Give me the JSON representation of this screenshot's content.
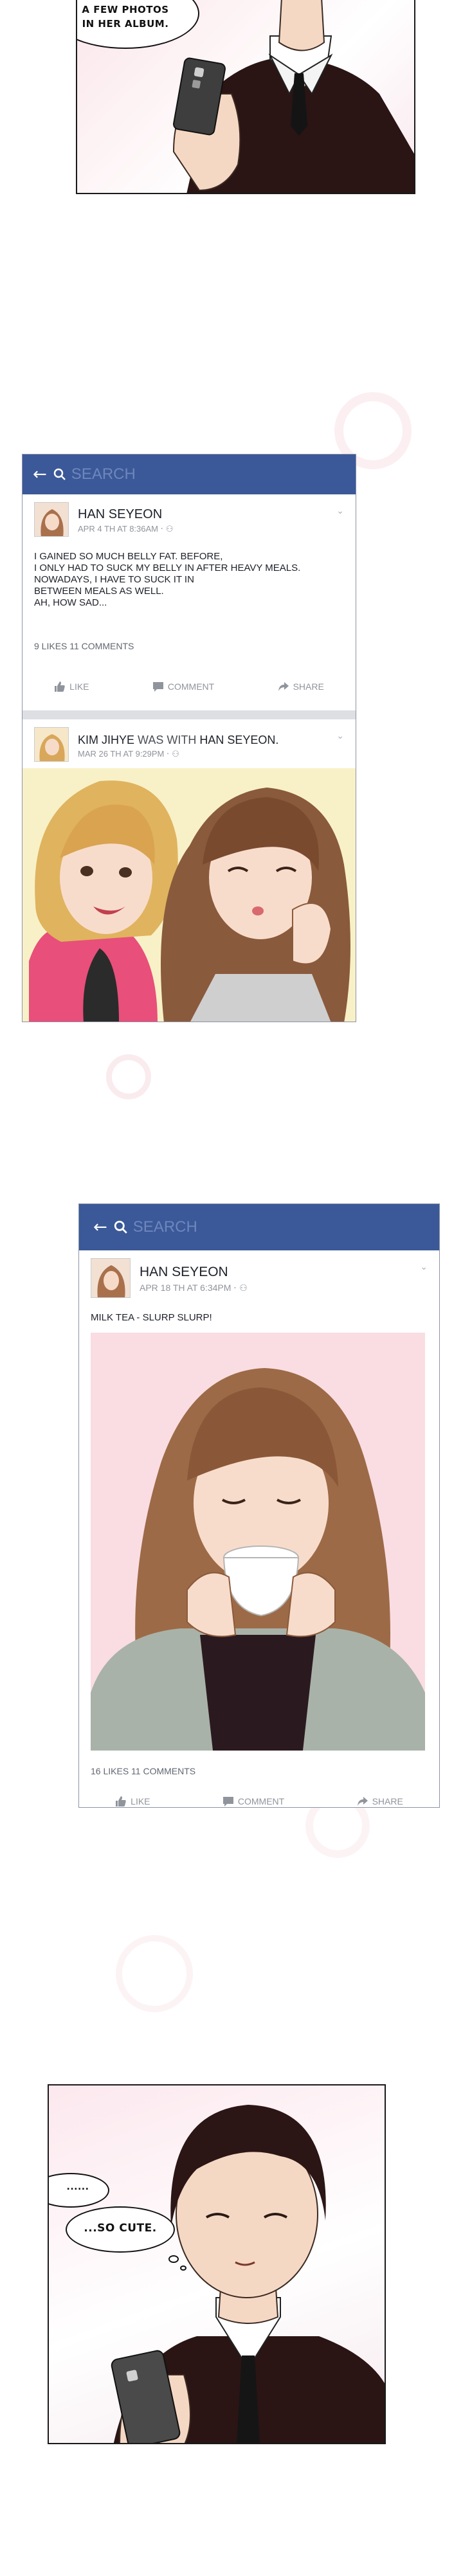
{
  "panel1": {
    "bubble": "A FEW PHOTOS IN HER ALBUM."
  },
  "feed1": {
    "back_icon": "arrow-left-icon",
    "search_placeholder": "SEARCH",
    "post1": {
      "name": "HAN SEYEON",
      "meta": "APR 4 TH AT 8:36AM",
      "text_lines": [
        "I GAINED SO MUCH BELLY FAT. BEFORE,",
        "I ONLY HAD TO SUCK MY BELLY IN AFTER HEAVY MEALS.",
        "NOWADAYS, I HAVE TO SUCK IT IN",
        "BETWEEN MEALS AS WELL.",
        "AH, HOW SAD..."
      ],
      "counts": "9 LIKES 11 COMMENTS",
      "like": "LIKE",
      "comment": "COMMENT",
      "share": "SHARE"
    },
    "post2": {
      "name_first": "KIM JIHYE",
      "name_mid": "WAS WITH",
      "name_second": "HAN SEYEON.",
      "meta": "MAR 26 TH AT 9:29PM"
    }
  },
  "feed2": {
    "back_icon": "arrow-left-icon",
    "search_placeholder": "SEARCH",
    "post": {
      "name": "HAN SEYEON",
      "meta": "APR 18 TH AT 6:34PM",
      "text": "MILK TEA - SLURP SLURP!",
      "counts": "16 LIKES 11 COMMENTS",
      "like": "LIKE",
      "comment": "COMMENT",
      "share": "SHARE"
    }
  },
  "panel_last": {
    "bubble_small": "......",
    "bubble_main": "...SO CUTE."
  },
  "colors": {
    "facebook_blue": "#3b5998",
    "search_text": "#6f86bd"
  }
}
